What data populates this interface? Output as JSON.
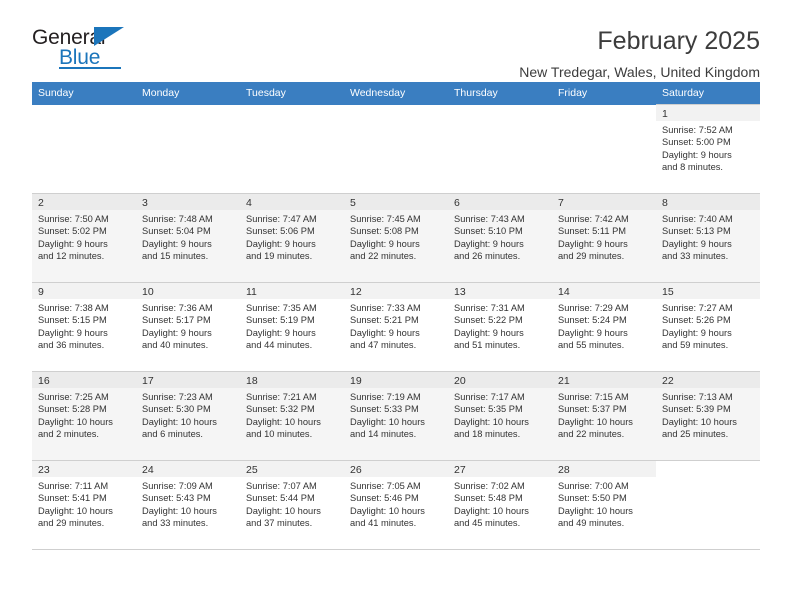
{
  "brand": {
    "word_one": "General",
    "word_two": "Blue",
    "accent_color": "#1b75bb",
    "triangle_icon": "triangle-icon"
  },
  "header": {
    "title": "February 2025",
    "subtitle": "New Tredegar, Wales, United Kingdom"
  },
  "calendar": {
    "header_bg": "#3a7ec1",
    "weekday_headers": [
      "Sunday",
      "Monday",
      "Tuesday",
      "Wednesday",
      "Thursday",
      "Friday",
      "Saturday"
    ],
    "weeks": [
      [
        {
          "day": "",
          "info": ""
        },
        {
          "day": "",
          "info": ""
        },
        {
          "day": "",
          "info": ""
        },
        {
          "day": "",
          "info": ""
        },
        {
          "day": "",
          "info": ""
        },
        {
          "day": "",
          "info": ""
        },
        {
          "day": "1",
          "info": "Sunrise: 7:52 AM\nSunset: 5:00 PM\nDaylight: 9 hours\nand 8 minutes."
        }
      ],
      [
        {
          "day": "2",
          "info": "Sunrise: 7:50 AM\nSunset: 5:02 PM\nDaylight: 9 hours\nand 12 minutes."
        },
        {
          "day": "3",
          "info": "Sunrise: 7:48 AM\nSunset: 5:04 PM\nDaylight: 9 hours\nand 15 minutes."
        },
        {
          "day": "4",
          "info": "Sunrise: 7:47 AM\nSunset: 5:06 PM\nDaylight: 9 hours\nand 19 minutes."
        },
        {
          "day": "5",
          "info": "Sunrise: 7:45 AM\nSunset: 5:08 PM\nDaylight: 9 hours\nand 22 minutes."
        },
        {
          "day": "6",
          "info": "Sunrise: 7:43 AM\nSunset: 5:10 PM\nDaylight: 9 hours\nand 26 minutes."
        },
        {
          "day": "7",
          "info": "Sunrise: 7:42 AM\nSunset: 5:11 PM\nDaylight: 9 hours\nand 29 minutes."
        },
        {
          "day": "8",
          "info": "Sunrise: 7:40 AM\nSunset: 5:13 PM\nDaylight: 9 hours\nand 33 minutes."
        }
      ],
      [
        {
          "day": "9",
          "info": "Sunrise: 7:38 AM\nSunset: 5:15 PM\nDaylight: 9 hours\nand 36 minutes."
        },
        {
          "day": "10",
          "info": "Sunrise: 7:36 AM\nSunset: 5:17 PM\nDaylight: 9 hours\nand 40 minutes."
        },
        {
          "day": "11",
          "info": "Sunrise: 7:35 AM\nSunset: 5:19 PM\nDaylight: 9 hours\nand 44 minutes."
        },
        {
          "day": "12",
          "info": "Sunrise: 7:33 AM\nSunset: 5:21 PM\nDaylight: 9 hours\nand 47 minutes."
        },
        {
          "day": "13",
          "info": "Sunrise: 7:31 AM\nSunset: 5:22 PM\nDaylight: 9 hours\nand 51 minutes."
        },
        {
          "day": "14",
          "info": "Sunrise: 7:29 AM\nSunset: 5:24 PM\nDaylight: 9 hours\nand 55 minutes."
        },
        {
          "day": "15",
          "info": "Sunrise: 7:27 AM\nSunset: 5:26 PM\nDaylight: 9 hours\nand 59 minutes."
        }
      ],
      [
        {
          "day": "16",
          "info": "Sunrise: 7:25 AM\nSunset: 5:28 PM\nDaylight: 10 hours\nand 2 minutes."
        },
        {
          "day": "17",
          "info": "Sunrise: 7:23 AM\nSunset: 5:30 PM\nDaylight: 10 hours\nand 6 minutes."
        },
        {
          "day": "18",
          "info": "Sunrise: 7:21 AM\nSunset: 5:32 PM\nDaylight: 10 hours\nand 10 minutes."
        },
        {
          "day": "19",
          "info": "Sunrise: 7:19 AM\nSunset: 5:33 PM\nDaylight: 10 hours\nand 14 minutes."
        },
        {
          "day": "20",
          "info": "Sunrise: 7:17 AM\nSunset: 5:35 PM\nDaylight: 10 hours\nand 18 minutes."
        },
        {
          "day": "21",
          "info": "Sunrise: 7:15 AM\nSunset: 5:37 PM\nDaylight: 10 hours\nand 22 minutes."
        },
        {
          "day": "22",
          "info": "Sunrise: 7:13 AM\nSunset: 5:39 PM\nDaylight: 10 hours\nand 25 minutes."
        }
      ],
      [
        {
          "day": "23",
          "info": "Sunrise: 7:11 AM\nSunset: 5:41 PM\nDaylight: 10 hours\nand 29 minutes."
        },
        {
          "day": "24",
          "info": "Sunrise: 7:09 AM\nSunset: 5:43 PM\nDaylight: 10 hours\nand 33 minutes."
        },
        {
          "day": "25",
          "info": "Sunrise: 7:07 AM\nSunset: 5:44 PM\nDaylight: 10 hours\nand 37 minutes."
        },
        {
          "day": "26",
          "info": "Sunrise: 7:05 AM\nSunset: 5:46 PM\nDaylight: 10 hours\nand 41 minutes."
        },
        {
          "day": "27",
          "info": "Sunrise: 7:02 AM\nSunset: 5:48 PM\nDaylight: 10 hours\nand 45 minutes."
        },
        {
          "day": "28",
          "info": "Sunrise: 7:00 AM\nSunset: 5:50 PM\nDaylight: 10 hours\nand 49 minutes."
        },
        {
          "day": "",
          "info": ""
        }
      ]
    ]
  }
}
